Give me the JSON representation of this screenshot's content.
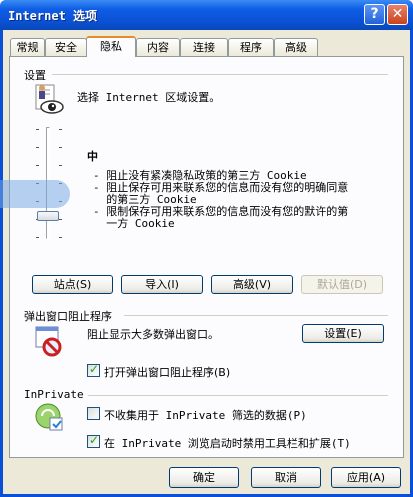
{
  "window": {
    "title": "Internet 选项",
    "help_glyph": "?",
    "close_glyph": "✕"
  },
  "tabs": [
    {
      "label": "常规"
    },
    {
      "label": "安全"
    },
    {
      "label": "隐私"
    },
    {
      "label": "内容"
    },
    {
      "label": "连接"
    },
    {
      "label": "程序"
    },
    {
      "label": "高级"
    }
  ],
  "settings": {
    "group_label": "设置",
    "prompt": "选择 Internet 区域设置。",
    "level": "中",
    "descriptions": [
      "- 阻止没有紧凑隐私政策的第三方 Cookie",
      "- 阻止保存可用来联系您的信息而没有您的明确同意",
      "  的第三方 Cookie",
      "- 限制保存可用来联系您的信息而没有您的默许的第",
      "  一方 Cookie"
    ],
    "buttons": {
      "sites": "站点(S)",
      "import": "导入(I)",
      "advanced": "高级(V)",
      "default": "默认值(D)"
    }
  },
  "popup": {
    "group_label": "弹出窗口阻止程序",
    "text": "阻止显示大多数弹出窗口。",
    "settings_button": "设置(E)",
    "enable_label": "打开弹出窗口阻止程序(B)",
    "enable_checked": true
  },
  "inprivate": {
    "group_label": "InPrivate",
    "nocollect_label": "不收集用于 InPrivate 筛选的数据(P)",
    "nocollect_checked": false,
    "disable_toolbars_label": "在 InPrivate 浏览启动时禁用工具栏和扩展(T)",
    "disable_toolbars_checked": true
  },
  "footer": {
    "ok": "确定",
    "cancel": "取消",
    "apply": "应用(A)"
  }
}
